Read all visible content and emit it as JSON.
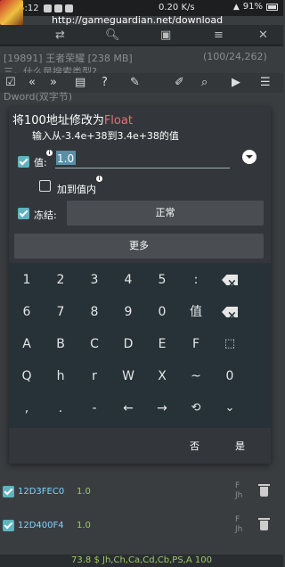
{
  "status_bar": {
    "time": "5:25:12",
    "net_speed": "0.20 K/s",
    "battery": "91%",
    "url": "http://gameguardian.net/download"
  },
  "background": {
    "process_line": "[19891] 王者荣耀 [238 MB]",
    "count": "(100/24,262)",
    "partial_1": "三，什么是搜索类型?",
    "partial_2": "Dword(双字节)"
  },
  "dialog": {
    "title_prefix": "将100地址修改为",
    "title_type": "Float",
    "subtitle": "输入从-3.4e+38到3.4e+38的值",
    "value_label": "值:",
    "value": "1.0",
    "within_label": "加到值内",
    "freeze_label": "冻结:",
    "freeze_mode": "正常",
    "more_label": "更多",
    "cancel_label": "否",
    "ok_label": "是"
  },
  "keyboard": {
    "rows": [
      [
        "1",
        "2",
        "3",
        "4",
        "5",
        ":",
        "backspace-icon"
      ],
      [
        "6",
        "7",
        "8",
        "9",
        "0",
        "值",
        "backspace-icon"
      ],
      [
        "A",
        "B",
        "C",
        "D",
        "E",
        "F",
        "select-all-icon"
      ],
      [
        "Q",
        "h",
        "r",
        "W",
        "X",
        "~",
        "0"
      ],
      [
        ",",
        ".",
        "-",
        "←",
        "→",
        "history-icon",
        "collapse-icon"
      ]
    ]
  },
  "list_rows": [
    {
      "address": "12D3FEC0",
      "value": "1.0",
      "type_line1": "F",
      "type_line2": "Jh"
    },
    {
      "address": "12D400F4",
      "value": "1.0",
      "type_line1": "F",
      "type_line2": "Jh"
    }
  ],
  "bottom_bar": "73.8 $ Jh,Ch,Ca,Cd,Cb,PS,A 100",
  "colors": {
    "accent": "#e57373",
    "checkbox": "#5fb3bf",
    "address": "#81d4fa",
    "value": "#9ccc65"
  }
}
